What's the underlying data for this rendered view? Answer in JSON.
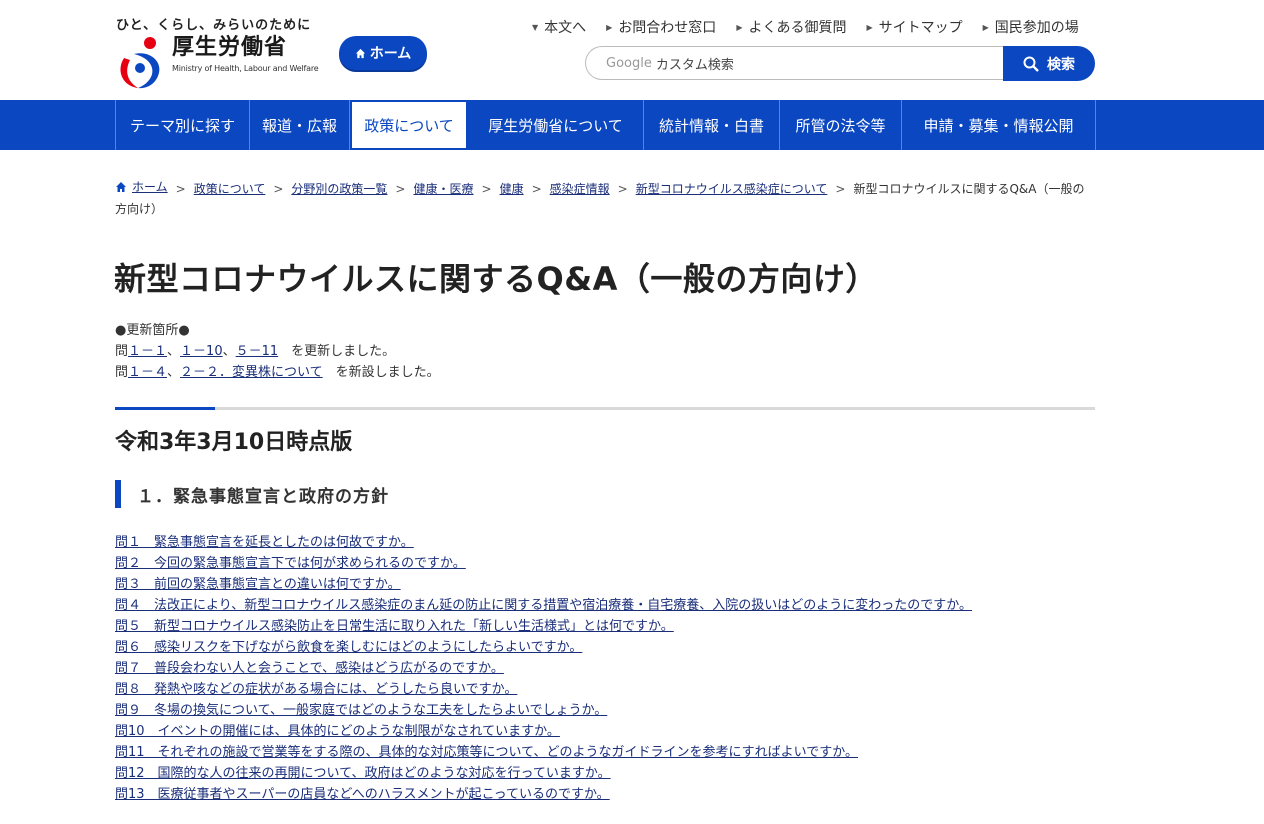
{
  "header": {
    "tagline": "ひと、くらし、みらいのために",
    "logo_jp": "厚生労働省",
    "logo_en": "Ministry of Health, Labour and Welfare",
    "home_label": "ホーム",
    "utility_links": [
      "本文へ",
      "お問合わせ窓口",
      "よくある御質問",
      "サイトマップ",
      "国民参加の場"
    ],
    "search_google": "Google",
    "search_placeholder": "カスタム検索",
    "search_button": "検索",
    "colors": {
      "brand": "#0b47c0"
    }
  },
  "nav": {
    "items": [
      {
        "label": "テーマ別に探す"
      },
      {
        "label": "報道・広報"
      },
      {
        "label": "政策について"
      },
      {
        "label": "厚生労働省について"
      },
      {
        "label": "統計情報・白書"
      },
      {
        "label": "所管の法令等"
      },
      {
        "label": "申請・募集・情報公開"
      }
    ]
  },
  "breadcrumb": {
    "items": [
      "ホーム",
      "政策について",
      "分野別の政策一覧",
      "健康・医療",
      "健康",
      "感染症情報",
      "新型コロナウイルス感染症について"
    ],
    "current": "新型コロナウイルスに関するQ&A（一般の方向け）"
  },
  "main": {
    "title": "新型コロナウイルスに関するQ&A（一般の方向け）",
    "update_heading": "●更新箇所●",
    "update1": {
      "prefix": "問",
      "links": [
        "１－１",
        "１－10",
        "５－11"
      ],
      "sep": "、",
      "suffix": "　を更新しました。"
    },
    "update2": {
      "prefix": "問",
      "links": [
        "１－４",
        "２－２．変異株について"
      ],
      "sep": "、",
      "suffix": "　を新設しました。"
    },
    "version": "令和3年3月10日時点版",
    "section1": "１．緊急事態宣言と政府の方針",
    "questions": [
      "問１　緊急事態宣言を延長としたのは何故ですか。",
      "問２　今回の緊急事態宣言下では何が求められるのですか。",
      "問３　前回の緊急事態宣言との違いは何ですか。",
      "問４　法改正により、新型コロナウイルス感染症のまん延の防止に関する措置や宿泊療養・自宅療養、入院の扱いはどのように変わったのですか。",
      "問５　新型コロナウイルス感染防止を日常生活に取り入れた「新しい生活様式」とは何ですか。",
      "問６　感染リスクを下げながら飲食を楽しむにはどのようにしたらよいですか。",
      "問７　普段会わない人と会うことで、感染はどう広がるのですか。",
      "問８　発熱や咳などの症状がある場合には、どうしたら良いですか。",
      "問９　冬場の換気について、一般家庭ではどのような工夫をしたらよいでしょうか。",
      "問10　イベントの開催には、具体的にどのような制限がなされていますか。",
      "問11　それぞれの施設で営業等をする際の、具体的な対応策等について、どのようなガイドラインを参考にすればよいですか。",
      "問12　国際的な人の往来の再開について、政府はどのような対応を行っていますか。",
      "問13　医療従事者やスーパーの店員などへのハラスメントが起こっているのですか。"
    ]
  }
}
